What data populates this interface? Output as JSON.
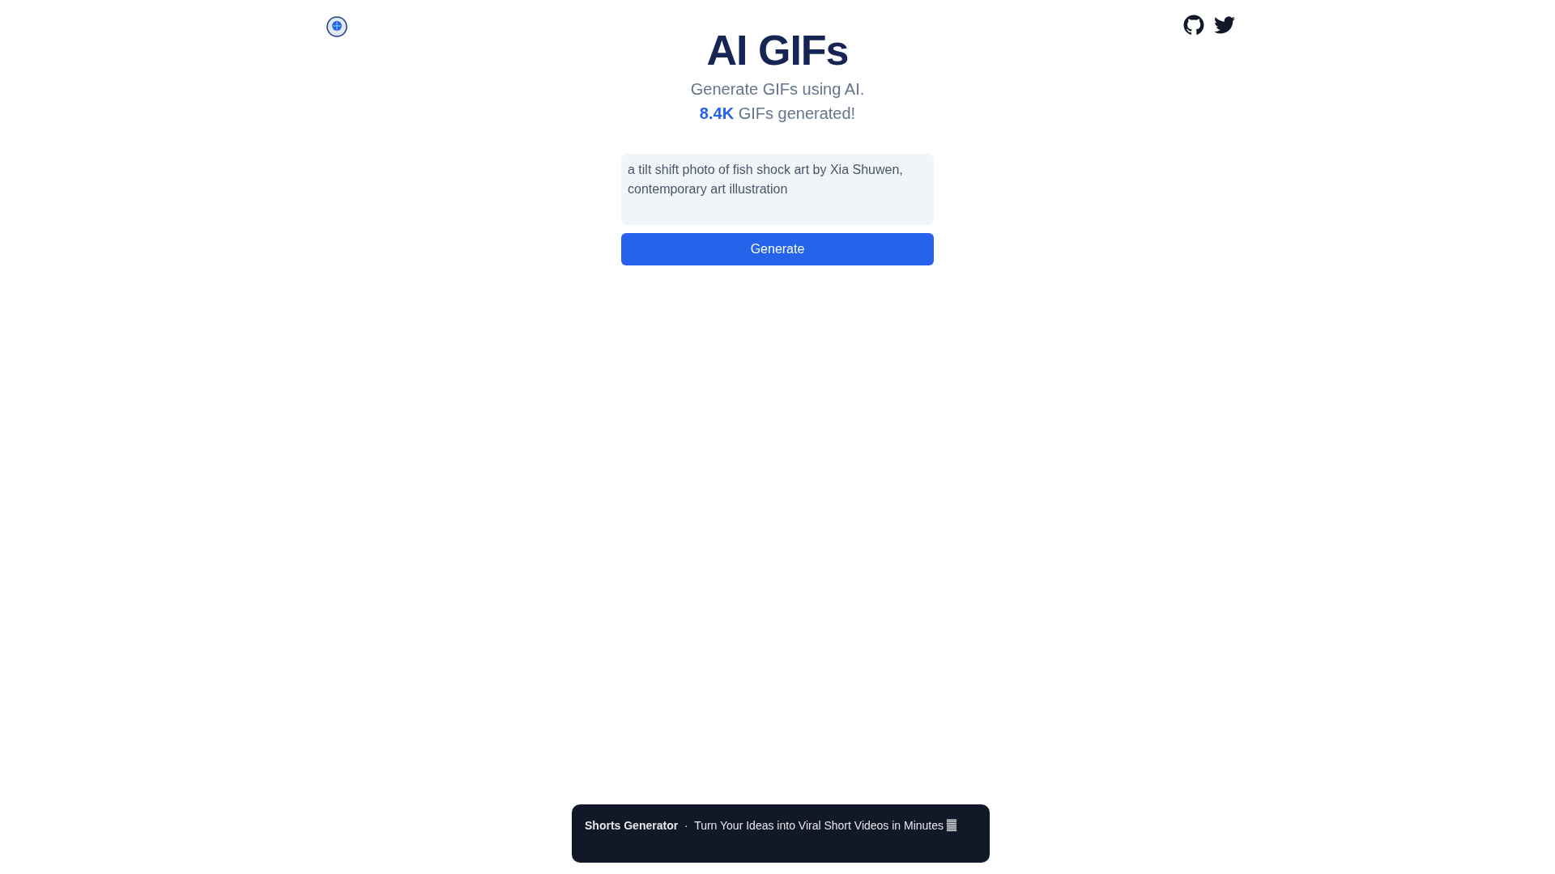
{
  "header": {
    "title": "AI GIFs",
    "subtitle": "Generate GIFs using AI.",
    "count": "8.4K",
    "count_suffix": "GIFs generated!"
  },
  "prompt": {
    "value": "a tilt shift photo of fish shock art by Xia Shuwen, contemporary art illustration"
  },
  "generate_button": "Generate",
  "banner": {
    "name": "Shorts Generator",
    "separator": "·",
    "text": "Turn Your Ideas into Viral Short Videos in Minutes"
  }
}
